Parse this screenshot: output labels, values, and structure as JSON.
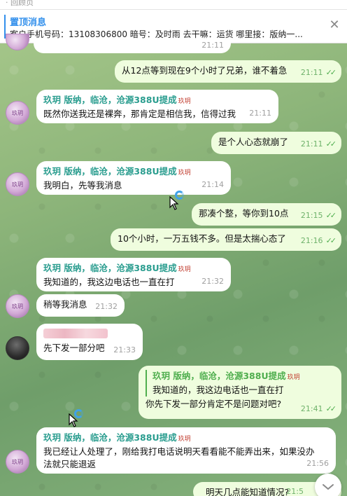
{
  "top_strip": {
    "label": "· 回顾页"
  },
  "pinned": {
    "title": "置顶消息",
    "text": "客户手机号码：13108306800 暗号：及时雨 去干嘛：运货 哪里接：版纳一..."
  },
  "sender_name": "玖玥 版纳，临沧，沧源388U提成",
  "sender_badge": "玖玥",
  "messages": [
    {
      "text": "从12点等到现在9个小时了兄弟，谁不着急",
      "time": "21:11"
    },
    {
      "text": "既然你送我还是裸奔，那肯定是相信我，信得过我",
      "time": "21:11"
    },
    {
      "text": "是个人心态就崩了",
      "time": "21:11"
    },
    {
      "text": "我明白，先等我消息",
      "time": "21:14"
    },
    {
      "text": "那凑个整，等你到10点",
      "time": "21:15"
    },
    {
      "text": "10个小时，一万五钱不多。但是太揣心态了",
      "time": "21:16"
    },
    {
      "text": "我知道的，我这边电话也一直在打",
      "time": "21:32"
    },
    {
      "text": "稍等我消息",
      "time": "21:32"
    },
    {
      "text": "先下发一部分吧",
      "time": "21:33"
    },
    {
      "quote": "我知道的，我这边电话也一直在打",
      "text": "你先下发一部分肯定不是问题对吧?",
      "time": "21:41"
    },
    {
      "text_line1": "我已经让人处理了，刚给我打电话说明天看看能不能弄出来，如果没办",
      "text_line2": "法就只能退返",
      "time": "21:56"
    },
    {
      "text": "明天几点能知道情况?",
      "time": "21:5"
    }
  ],
  "partial_top": {
    "text": "…",
    "time": "21:11"
  },
  "icons": [
    "close-icon",
    "read-check-icon",
    "chevron-down-icon",
    "cursor-icon",
    "loading-ring-icon"
  ]
}
